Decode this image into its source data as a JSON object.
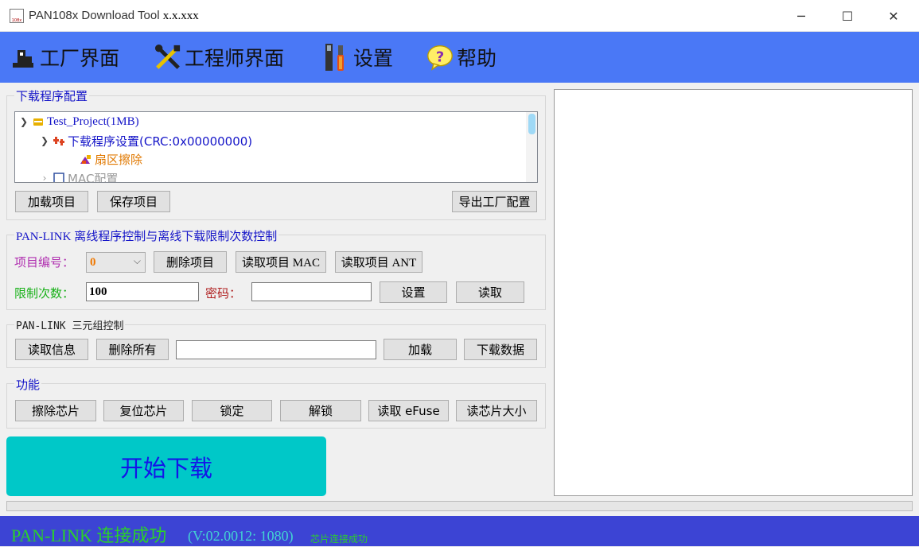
{
  "window": {
    "title_prefix": "PAN108x Download Tool",
    "title_version": "x.x.xxx",
    "icon_text": "108x",
    "minimize_symbol": "─",
    "maximize_symbol": "☐",
    "close_symbol": "✕"
  },
  "menu": {
    "factory": "工厂界面",
    "engineer": "工程师界面",
    "settings": "设置",
    "help": "帮助"
  },
  "download_config": {
    "legend": "下载程序配置",
    "tree": {
      "project": "Test_Project(1MB)",
      "download_settings": "下载程序设置(CRC:0x00000000)",
      "sector_erase": "扇区擦除",
      "mac_config": "MAC配置"
    },
    "load_button": "加载项目",
    "save_button": "保存项目",
    "export_button": "导出工厂配置"
  },
  "offline_control": {
    "legend": "PAN-LINK 离线程序控制与离线下载限制次数控制",
    "project_no_label": "项目编号：",
    "project_no_value": "0",
    "delete_project": "删除项目",
    "read_mac": "读取项目 MAC",
    "read_ant": "读取项目 ANT",
    "limit_label": "限制次数：",
    "limit_value": "100",
    "password_label": "密码：",
    "password_value": "",
    "set_button": "设置",
    "read_button": "读取"
  },
  "triple_control": {
    "legend": "PAN-LINK 三元组控制",
    "read_info": "读取信息",
    "delete_all": "删除所有",
    "input_value": "",
    "load": "加载",
    "download_data": "下载数据"
  },
  "functions": {
    "legend": "功能",
    "erase_chip": "擦除芯片",
    "reset_chip": "复位芯片",
    "lock": "锁定",
    "unlock": "解锁",
    "read_efuse": "读取 eFuse",
    "read_chip_size": "读芯片大小"
  },
  "start_button": "开始下载",
  "progress": 0,
  "status": {
    "main": "PAN-LINK 连接成功",
    "version": "(V:02.0012: 1080)",
    "sub": "芯片连接成功"
  },
  "colors": {
    "menubar": "#4a78f6",
    "start_button": "#00c8c8",
    "statusbar": "#3c44d4",
    "status_ok": "#2bd02b",
    "legend": "#1515c8"
  }
}
